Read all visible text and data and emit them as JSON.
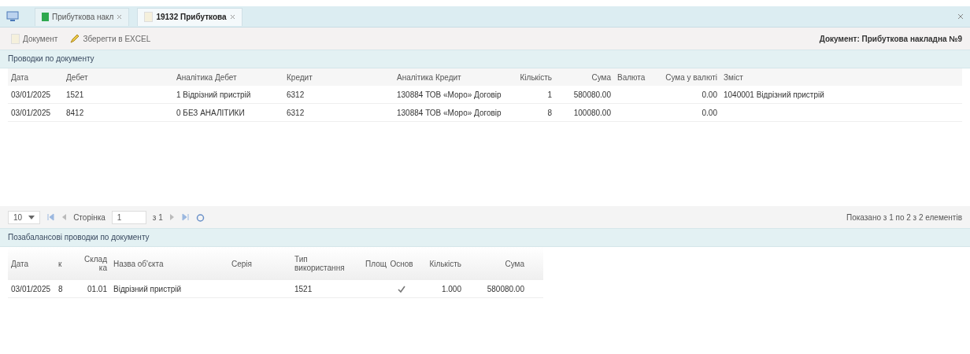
{
  "tabs": [
    {
      "label": "Прибуткова накл",
      "selected": false
    },
    {
      "label": "19132 Прибуткова",
      "selected": true
    }
  ],
  "toolbar": {
    "buttons": [
      {
        "label": "Документ"
      },
      {
        "label": "Зберегти в EXCEL"
      }
    ],
    "document_title": "Документ: Прибуткова накладна №9"
  },
  "entries": {
    "title": "Проводки по документу",
    "columns": [
      "Дата",
      "Дебет",
      "Аналітика Дебет",
      "Кредит",
      "Аналітика Кредит",
      "Кількість",
      "Сума",
      "Валюта",
      "Сума у валюті",
      "Зміст"
    ],
    "rows": [
      [
        "03/01/2025",
        "1521",
        "1 Відрізний пристрій",
        "6312",
        "130884 ТОВ «Моро» Договір",
        "1",
        "580080.00",
        "",
        "0.00",
        "1040001 Відрізний пристрій"
      ],
      [
        "03/01/2025",
        "8412",
        "0 БЕЗ АНАЛІТИКИ",
        "6312",
        "130884 ТОВ «Моро» Договір",
        "8",
        "100080.00",
        "",
        "0.00",
        ""
      ]
    ]
  },
  "pager": {
    "page_size": "10",
    "page_label": "Сторінка",
    "page": "1",
    "of": "з 1",
    "summary": "Показано з 1 по 2 з 2 елементів"
  },
  "offbalance": {
    "title": "Позабалансові проводки по документу",
    "columns": [
      "Дата",
      "к",
      "Склад ка",
      "Назва об'єкта",
      "Серія",
      "Тип використання",
      "Площ",
      "Основ",
      "Кількість",
      "Сума"
    ],
    "rows": [
      [
        {
          "kind": "text",
          "text": "03/01/2025"
        },
        {
          "kind": "text",
          "text": "8"
        },
        {
          "kind": "text",
          "text": "01.01"
        },
        {
          "kind": "text",
          "text": "Відрізний пристрій"
        },
        {
          "kind": "text",
          "text": ""
        },
        {
          "kind": "text",
          "text": "1521"
        },
        {
          "kind": "text",
          "text": ""
        },
        {
          "kind": "check",
          "checked": true
        },
        {
          "kind": "text",
          "text": "1.000"
        },
        {
          "kind": "text",
          "text": "580080.00"
        }
      ]
    ]
  }
}
